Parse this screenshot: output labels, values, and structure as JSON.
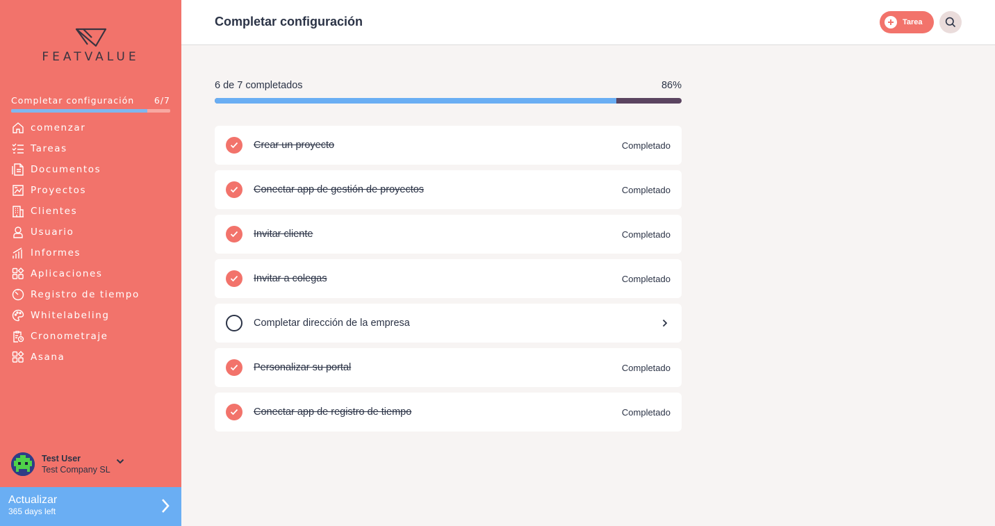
{
  "brand": {
    "logo_text": "FEATVALUE"
  },
  "sidebar": {
    "setup": {
      "label": "Completar configuración",
      "count": "6/7",
      "progress": 0.857
    },
    "items": [
      {
        "label": "comenzar",
        "icon": "home-icon"
      },
      {
        "label": "Tareas",
        "icon": "tasks-icon"
      },
      {
        "label": "Documentos",
        "icon": "documents-icon"
      },
      {
        "label": "Proyectos",
        "icon": "projects-icon"
      },
      {
        "label": "Clientes",
        "icon": "clients-icon"
      },
      {
        "label": "Usuario",
        "icon": "user-icon"
      },
      {
        "label": "Informes",
        "icon": "reports-icon"
      },
      {
        "label": "Aplicaciones",
        "icon": "apps-icon"
      },
      {
        "label": "Registro de tiempo",
        "icon": "timer-icon"
      },
      {
        "label": "Whitelabeling",
        "icon": "palette-icon"
      },
      {
        "label": "Cronometraje",
        "icon": "stopwatch-clipboard-icon"
      },
      {
        "label": "Asana",
        "icon": "apps-icon"
      }
    ],
    "user": {
      "name": "Test User",
      "company": "Test Company SL"
    },
    "upgrade": {
      "title": "Actualizar",
      "subtitle": "365 days left"
    }
  },
  "header": {
    "title": "Completar configuración",
    "task_button": "Tarea"
  },
  "progress": {
    "summary": "6 de 7 completados",
    "percent": "86%",
    "value": 0.86
  },
  "tasks": [
    {
      "label": "Crear un proyecto",
      "status": "Completado",
      "done": true
    },
    {
      "label": "Conectar app de gestión de proyectos",
      "status": "Completado",
      "done": true
    },
    {
      "label": "Invitar cliente",
      "status": "Completado",
      "done": true
    },
    {
      "label": "Invitar a colegas",
      "status": "Completado",
      "done": true
    },
    {
      "label": "Completar dirección de la empresa",
      "status": "",
      "done": false
    },
    {
      "label": "Personalizar su portal",
      "status": "Completado",
      "done": true
    },
    {
      "label": "Conectar app de registro de tiempo",
      "status": "Completado",
      "done": true
    }
  ],
  "colors": {
    "accent": "#f2736b",
    "blue": "#6aaef3",
    "text": "#2b3346",
    "track": "#5b4460"
  }
}
